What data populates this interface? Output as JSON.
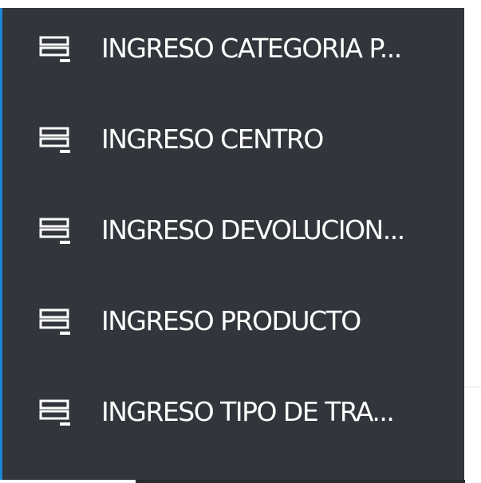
{
  "menu": {
    "items": [
      {
        "label": "INGRESO CATEGORIA P...",
        "icon": "form-icon"
      },
      {
        "label": "INGRESO CENTRO",
        "icon": "form-icon"
      },
      {
        "label": "INGRESO DEVOLUCION...",
        "icon": "form-icon"
      },
      {
        "label": "INGRESO PRODUCTO",
        "icon": "form-icon"
      },
      {
        "label": "INGRESO TIPO DE TRA...",
        "icon": "form-icon"
      }
    ]
  },
  "colors": {
    "panel_background": "#32363c",
    "accent_border": "#1f86d6",
    "text": "#ffffff"
  }
}
